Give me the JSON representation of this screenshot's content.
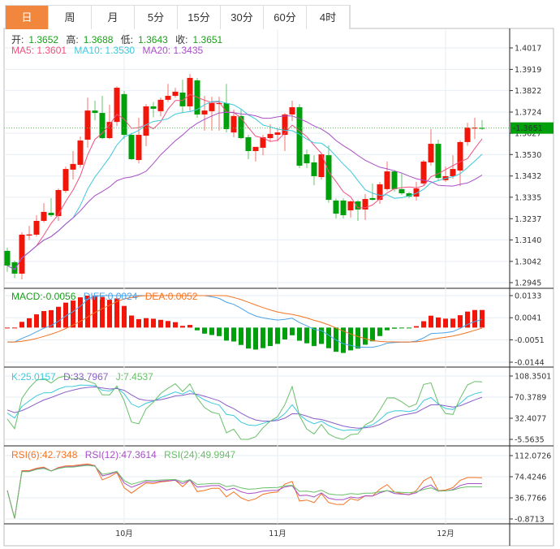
{
  "tabs": [
    {
      "label": "日",
      "active": true
    },
    {
      "label": "周",
      "active": false
    },
    {
      "label": "月",
      "active": false
    },
    {
      "label": "5分",
      "active": false
    },
    {
      "label": "15分",
      "active": false
    },
    {
      "label": "30分",
      "active": false
    },
    {
      "label": "60分",
      "active": false
    },
    {
      "label": "4时",
      "active": false
    }
  ],
  "ohlc_legend": {
    "open_label": "开:",
    "open": "1.3652",
    "high_label": "高:",
    "high": "1.3688",
    "low_label": "低:",
    "low": "1.3643",
    "close_label": "收:",
    "close": "1.3651"
  },
  "ma_legend": {
    "ma5": "MA5: 1.3601",
    "ma10": "MA10: 1.3530",
    "ma20": "MA20: 1.3435"
  },
  "macd_legend": {
    "macd": "MACD:-0.0056",
    "diff": "DIFF:0.0024",
    "dea": "DEA:0.0052"
  },
  "kdj_legend": {
    "k": "K:25.0157",
    "d": "D:33.7967",
    "j": "J:7.4537"
  },
  "rsi_legend": {
    "rsi6": "RSI(6):42.7348",
    "rsi12": "RSI(12):47.3614",
    "rsi24": "RSI(24):49.9947"
  },
  "last_price": "1.3651",
  "colors": {
    "up": "#f2150a",
    "down": "#00a00c",
    "ma5": "#f0527f",
    "ma10": "#3ec9dd",
    "ma20": "#a94fc6",
    "diff": "#4aa3ea",
    "dea": "#f57321",
    "accent": "#f0873c"
  },
  "chart_data": {
    "type": "candlestick",
    "price_axis_ticks": [
      "1.4017",
      "1.3919",
      "1.3822",
      "1.3724",
      "1.3627",
      "1.3530",
      "1.3432",
      "1.3335",
      "1.3237",
      "1.3140",
      "1.3042",
      "1.2945"
    ],
    "price_range": [
      1.2945,
      1.4017
    ],
    "macd_axis_ticks": [
      "0.0133",
      "0.0041",
      "-0.0051",
      "-0.0144"
    ],
    "macd_range": [
      -0.0144,
      0.0133
    ],
    "kdj_axis_ticks": [
      "108.3501",
      "70.3789",
      "32.4077",
      "-5.5635"
    ],
    "kdj_range": [
      -5.5635,
      108.3501
    ],
    "rsi_axis_ticks": [
      "112.0726",
      "74.4246",
      "36.7766",
      "-0.8713"
    ],
    "rsi_range": [
      -0.8713,
      112.0726
    ],
    "month_labels": [
      {
        "index": 16,
        "label": "10月"
      },
      {
        "index": 37,
        "label": "11月"
      },
      {
        "index": 60,
        "label": "12月"
      }
    ],
    "candles": [
      [
        1.309,
        1.3105,
        1.2995,
        1.3023
      ],
      [
        1.3038,
        1.3045,
        1.2965,
        1.2986
      ],
      [
        1.2986,
        1.3175,
        1.296,
        1.3164
      ],
      [
        1.316,
        1.3204,
        1.314,
        1.3165
      ],
      [
        1.3164,
        1.3253,
        1.3155,
        1.3227
      ],
      [
        1.3227,
        1.3308,
        1.322,
        1.3268
      ],
      [
        1.3264,
        1.3331,
        1.3245,
        1.3253
      ],
      [
        1.3249,
        1.3375,
        1.3227,
        1.3368
      ],
      [
        1.3364,
        1.3475,
        1.3355,
        1.3464
      ],
      [
        1.3461,
        1.3546,
        1.3416,
        1.3487
      ],
      [
        1.3483,
        1.3612,
        1.347,
        1.3594
      ],
      [
        1.3598,
        1.379,
        1.3561,
        1.3731
      ],
      [
        1.3731,
        1.3776,
        1.3686,
        1.372
      ],
      [
        1.372,
        1.3798,
        1.36,
        1.3605
      ],
      [
        1.3605,
        1.3757,
        1.36,
        1.3679
      ],
      [
        1.3679,
        1.3842,
        1.366,
        1.3835
      ],
      [
        1.3806,
        1.382,
        1.36,
        1.362
      ],
      [
        1.362,
        1.363,
        1.3505,
        1.3509
      ],
      [
        1.3505,
        1.3698,
        1.349,
        1.362
      ],
      [
        1.3616,
        1.376,
        1.3568,
        1.375
      ],
      [
        1.375,
        1.377,
        1.37,
        1.3739
      ],
      [
        1.3728,
        1.379,
        1.3705,
        1.378
      ],
      [
        1.378,
        1.3853,
        1.377,
        1.3798
      ],
      [
        1.3798,
        1.3835,
        1.379,
        1.3817
      ],
      [
        1.3813,
        1.3872,
        1.372,
        1.375
      ],
      [
        1.375,
        1.3898,
        1.373,
        1.388
      ],
      [
        1.3869,
        1.388,
        1.3698,
        1.3713
      ],
      [
        1.3713,
        1.3798,
        1.3639,
        1.3731
      ],
      [
        1.3728,
        1.3794,
        1.3639,
        1.3765
      ],
      [
        1.3761,
        1.3794,
        1.3639,
        1.3765
      ],
      [
        1.3765,
        1.3853,
        1.3631,
        1.3646
      ],
      [
        1.3631,
        1.3735,
        1.3609,
        1.3706
      ],
      [
        1.3706,
        1.3735,
        1.36,
        1.3605
      ],
      [
        1.3609,
        1.362,
        1.3509,
        1.3546
      ],
      [
        1.3546,
        1.356,
        1.3498,
        1.3565
      ],
      [
        1.3561,
        1.362,
        1.3527,
        1.3609
      ],
      [
        1.3605,
        1.3668,
        1.359,
        1.3624
      ],
      [
        1.362,
        1.365,
        1.359,
        1.3631
      ],
      [
        1.362,
        1.372,
        1.3546,
        1.3713
      ],
      [
        1.3713,
        1.3776,
        1.3683,
        1.3746
      ],
      [
        1.3746,
        1.376,
        1.3468,
        1.3479
      ],
      [
        1.3531,
        1.3553,
        1.3468,
        1.349
      ],
      [
        1.3494,
        1.3527,
        1.339,
        1.3431
      ],
      [
        1.3427,
        1.3535,
        1.3416,
        1.3531
      ],
      [
        1.3527,
        1.3572,
        1.331,
        1.3323
      ],
      [
        1.332,
        1.333,
        1.3238,
        1.326
      ],
      [
        1.332,
        1.333,
        1.3238,
        1.3253
      ],
      [
        1.3275,
        1.332,
        1.3242,
        1.3316
      ],
      [
        1.3316,
        1.3322,
        1.3227,
        1.3279
      ],
      [
        1.3279,
        1.335,
        1.3231,
        1.3327
      ],
      [
        1.3331,
        1.3398,
        1.332,
        1.3323
      ],
      [
        1.3323,
        1.3405,
        1.3305,
        1.3394
      ],
      [
        1.3372,
        1.3498,
        1.3365,
        1.3453
      ],
      [
        1.3453,
        1.346,
        1.3361,
        1.3372
      ],
      [
        1.3372,
        1.3442,
        1.3346,
        1.3353
      ],
      [
        1.3353,
        1.336,
        1.333,
        1.3338
      ],
      [
        1.3338,
        1.3405,
        1.332,
        1.3375
      ],
      [
        1.3398,
        1.3505,
        1.339,
        1.3498
      ],
      [
        1.3494,
        1.3646,
        1.348,
        1.3579
      ],
      [
        1.3579,
        1.3598,
        1.341,
        1.3423
      ],
      [
        1.3413,
        1.3475,
        1.3405,
        1.3431
      ],
      [
        1.3431,
        1.3527,
        1.342,
        1.3464
      ],
      [
        1.3457,
        1.3595,
        1.3386,
        1.3587
      ],
      [
        1.3587,
        1.3675,
        1.357,
        1.3653
      ],
      [
        1.3652,
        1.3698,
        1.36,
        1.3653
      ],
      [
        1.3652,
        1.3688,
        1.3643,
        1.3651
      ]
    ]
  }
}
